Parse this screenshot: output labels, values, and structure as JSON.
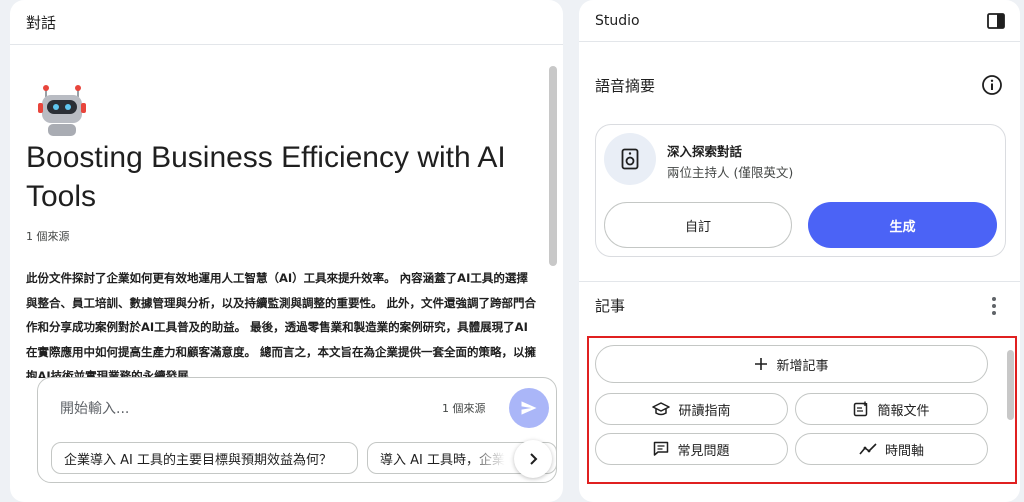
{
  "chat": {
    "header": "對話",
    "title": "Boosting Business Efficiency with AI Tools",
    "source_count": "1 個來源",
    "summary": "此份文件探討了企業如何更有效地運用人工智慧（AI）工具來提升效率。 內容涵蓋了AI工具的選擇與整合、員工培訓、數據管理與分析，以及持續監測與調整的重要性。 此外，文件還強調了跨部門合作和分享成功案例對於AI工具普及的助益。 最後，透過零售業和製造業的案例研究，具體展現了AI在實際應用中如何提高生產力和顧客滿意度。 總而言之，本文旨在為企業提供一套全面的策略，以擁抱AI技術並實現業務的永續發展。",
    "input": {
      "placeholder": "開始輸入...",
      "source_count": "1 個來源"
    },
    "suggestions": [
      "企業導入 AI 工具的主要目標與預期效益為何？",
      "導入 AI 工具時，企業"
    ]
  },
  "studio": {
    "header": "Studio",
    "audio_overview": {
      "title": "語音摘要",
      "card_title": "深入探索對話",
      "card_subtitle": "兩位主持人 (僅限英文)",
      "customize_label": "自訂",
      "generate_label": "生成"
    },
    "notes": {
      "title": "記事",
      "add_note_label": "新增記事",
      "buttons": {
        "study_guide": "研讀指南",
        "briefing": "簡報文件",
        "faq": "常見問題",
        "timeline": "時間軸"
      }
    }
  },
  "colors": {
    "accent": "#4b63f6",
    "send_button": "#aab6f8",
    "highlight": "#e02020"
  }
}
